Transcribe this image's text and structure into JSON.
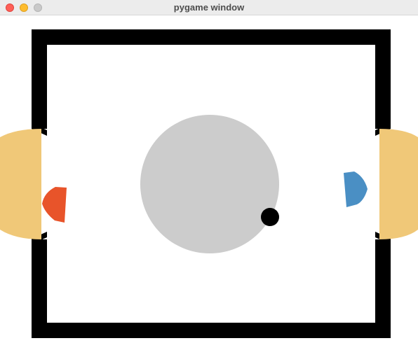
{
  "window": {
    "title": "pygame window",
    "controls": {
      "close": "close-button",
      "minimize": "minimize-button",
      "zoom": "zoom-button"
    }
  },
  "game": {
    "colors": {
      "background": "#ffffff",
      "rink_wall": "#000000",
      "goal_area": "#f0c878",
      "center_circle": "#cccccc",
      "puck": "#000000",
      "left_mallet": "#e8542a",
      "right_mallet": "#4a8fc4"
    },
    "objects": {
      "left_mallet": "red-player-mallet",
      "right_mallet": "blue-player-mallet",
      "puck": "puck"
    }
  }
}
